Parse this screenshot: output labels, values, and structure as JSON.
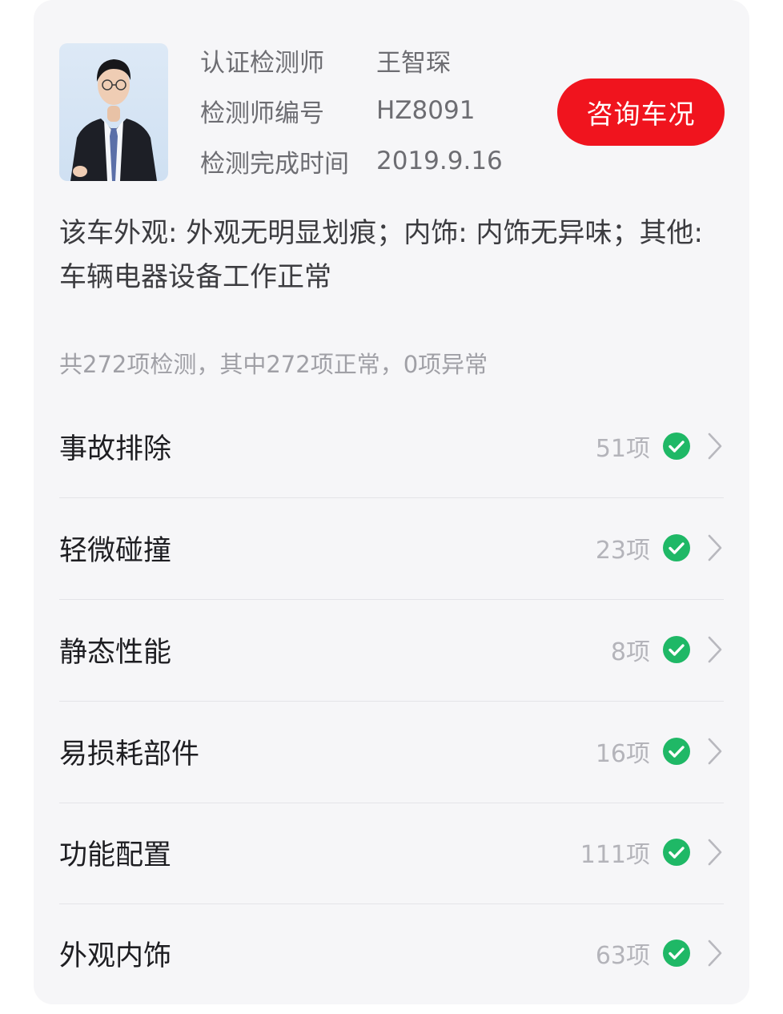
{
  "inspector": {
    "rows": [
      {
        "label": "认证检测师",
        "value": "王智琛"
      },
      {
        "label": "检测师编号",
        "value": "HZ8091"
      },
      {
        "label": "检测完成时间",
        "value": "2019.9.16"
      }
    ],
    "consult_button": "咨询车况"
  },
  "summary": "该车外观: 外观无明显划痕；内饰: 内饰无异味；其他: 车辆电器设备工作正常",
  "stats": "共272项检测，其中272项正常，0项异常",
  "categories": [
    {
      "name": "事故排除",
      "count": "51项"
    },
    {
      "name": "轻微碰撞",
      "count": "23项"
    },
    {
      "name": "静态性能",
      "count": "8项"
    },
    {
      "name": "易损耗部件",
      "count": "16项"
    },
    {
      "name": "功能配置",
      "count": "111项"
    },
    {
      "name": "外观内饰",
      "count": "63项"
    }
  ],
  "colors": {
    "accent": "#f0141e",
    "check": "#1fb866",
    "card_bg": "#f6f6f8"
  },
  "icons": {
    "check": "check-circle-icon",
    "chevron": "chevron-right-icon"
  }
}
